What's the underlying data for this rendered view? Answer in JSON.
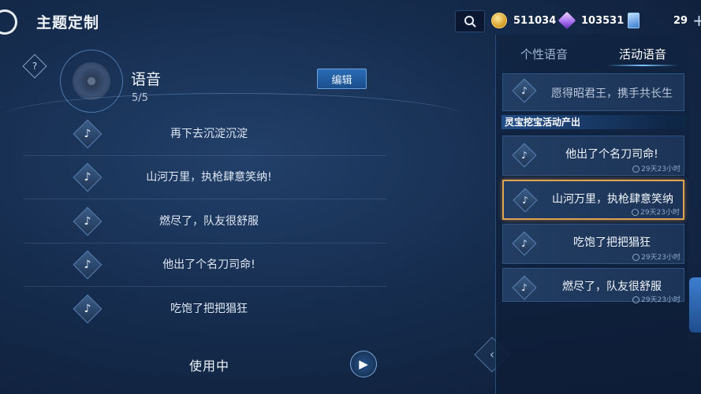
{
  "header": {
    "title": "主题定制",
    "currencies": [
      {
        "icon": "gold-coin-icon",
        "value": "511034"
      },
      {
        "icon": "diamond-gem-icon",
        "value": "103531"
      },
      {
        "icon": "card-ticket-icon",
        "value": "29"
      }
    ]
  },
  "left_panel": {
    "section_label": "语音",
    "count": "5/5",
    "edit_label": "编辑",
    "voices": [
      "再下去沉淀沉淀",
      "山河万里，执枪肆意笑纳!",
      "燃尽了，队友很舒服",
      "他出了个名刀司命!",
      "吃饱了把把猖狂"
    ],
    "in_use_label": "使用中"
  },
  "right_panel": {
    "tabs": [
      "个性语音",
      "活动语音"
    ],
    "active_tab": "活动语音",
    "top_item": "愿得昭君王，携手共长生",
    "section_header": "灵宝挖宝活动产出",
    "items": [
      {
        "name": "他出了个名刀司命!",
        "time": "29天23小时"
      },
      {
        "name": "山河万里，执枪肆意笑纳",
        "time": "29天23小时",
        "selected": true
      },
      {
        "name": "吃饱了把把猖狂",
        "time": "29天23小时"
      },
      {
        "name": "燃尽了，队友很舒服",
        "time": "29天23小时"
      }
    ]
  },
  "colors": {
    "accent": "#e0a34f",
    "panel": "#1c3457",
    "button": "#2a6bb4"
  }
}
